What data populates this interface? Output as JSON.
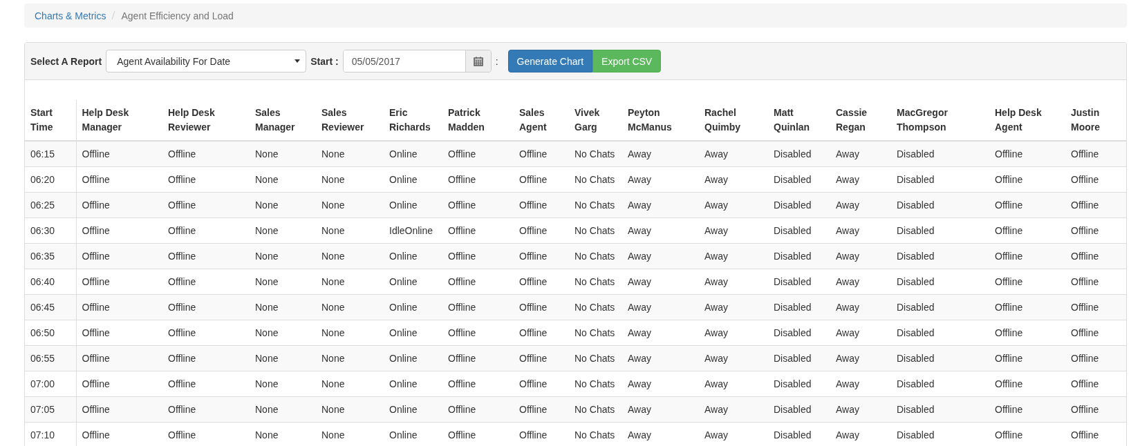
{
  "breadcrumb": [
    {
      "label": "Charts & Metrics",
      "kind": "link"
    },
    {
      "label": "Agent Efficiency and Load",
      "kind": "current"
    }
  ],
  "toolbar": {
    "report_label": "Select A Report",
    "report_value": "Agent Availability For Date",
    "start_label": "Start :",
    "start_value": "05/05/2017",
    "separator": ":",
    "buttons": [
      {
        "label": "Generate Chart",
        "kind": "primary"
      },
      {
        "label": "Export CSV",
        "kind": "success"
      }
    ]
  },
  "table": {
    "columns": [
      "Start Time",
      "Help Desk Manager",
      "Help Desk Reviewer",
      "Sales Manager",
      "Sales Reviewer",
      "Eric Richards",
      "Patrick Madden",
      "Sales Agent",
      "Vivek Garg",
      "Peyton McManus",
      "Rachel Quimby",
      "Matt Quinlan",
      "Cassie Regan",
      "MacGregor Thompson",
      "Help Desk Agent",
      "Justin Moore"
    ],
    "rows": [
      [
        "06:15",
        "Offline",
        "Offline",
        "None",
        "None",
        "Online",
        "Offline",
        "Offline",
        "No Chats",
        "Away",
        "Away",
        "Disabled",
        "Away",
        "Disabled",
        "Offline",
        "Offline"
      ],
      [
        "06:20",
        "Offline",
        "Offline",
        "None",
        "None",
        "Online",
        "Offline",
        "Offline",
        "No Chats",
        "Away",
        "Away",
        "Disabled",
        "Away",
        "Disabled",
        "Offline",
        "Offline"
      ],
      [
        "06:25",
        "Offline",
        "Offline",
        "None",
        "None",
        "Online",
        "Offline",
        "Offline",
        "No Chats",
        "Away",
        "Away",
        "Disabled",
        "Away",
        "Disabled",
        "Offline",
        "Offline"
      ],
      [
        "06:30",
        "Offline",
        "Offline",
        "None",
        "None",
        "IdleOnline",
        "Offline",
        "Offline",
        "No Chats",
        "Away",
        "Away",
        "Disabled",
        "Away",
        "Disabled",
        "Offline",
        "Offline"
      ],
      [
        "06:35",
        "Offline",
        "Offline",
        "None",
        "None",
        "Online",
        "Offline",
        "Offline",
        "No Chats",
        "Away",
        "Away",
        "Disabled",
        "Away",
        "Disabled",
        "Offline",
        "Offline"
      ],
      [
        "06:40",
        "Offline",
        "Offline",
        "None",
        "None",
        "Online",
        "Offline",
        "Offline",
        "No Chats",
        "Away",
        "Away",
        "Disabled",
        "Away",
        "Disabled",
        "Offline",
        "Offline"
      ],
      [
        "06:45",
        "Offline",
        "Offline",
        "None",
        "None",
        "Online",
        "Offline",
        "Offline",
        "No Chats",
        "Away",
        "Away",
        "Disabled",
        "Away",
        "Disabled",
        "Offline",
        "Offline"
      ],
      [
        "06:50",
        "Offline",
        "Offline",
        "None",
        "None",
        "Online",
        "Offline",
        "Offline",
        "No Chats",
        "Away",
        "Away",
        "Disabled",
        "Away",
        "Disabled",
        "Offline",
        "Offline"
      ],
      [
        "06:55",
        "Offline",
        "Offline",
        "None",
        "None",
        "Online",
        "Offline",
        "Offline",
        "No Chats",
        "Away",
        "Away",
        "Disabled",
        "Away",
        "Disabled",
        "Offline",
        "Offline"
      ],
      [
        "07:00",
        "Offline",
        "Offline",
        "None",
        "None",
        "Online",
        "Offline",
        "Offline",
        "No Chats",
        "Away",
        "Away",
        "Disabled",
        "Away",
        "Disabled",
        "Offline",
        "Offline"
      ],
      [
        "07:05",
        "Offline",
        "Offline",
        "None",
        "None",
        "Online",
        "Offline",
        "Offline",
        "No Chats",
        "Away",
        "Away",
        "Disabled",
        "Away",
        "Disabled",
        "Offline",
        "Offline"
      ],
      [
        "07:10",
        "Offline",
        "Offline",
        "None",
        "None",
        "Online",
        "Offline",
        "Offline",
        "No Chats",
        "Away",
        "Away",
        "Disabled",
        "Away",
        "Disabled",
        "Offline",
        "Offline"
      ]
    ]
  }
}
